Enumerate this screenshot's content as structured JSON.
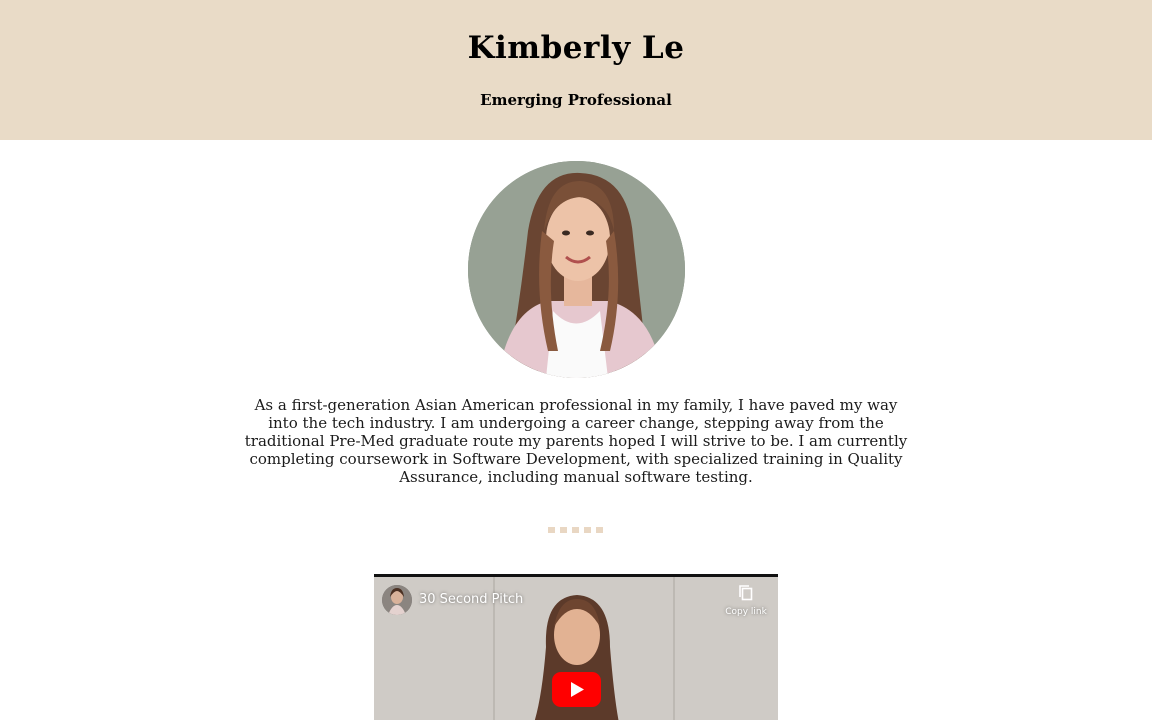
{
  "header": {
    "name": "Kimberly Le",
    "subtitle": "Emerging Professional"
  },
  "bio": {
    "text": "As a first-generation Asian American professional in my family, I have paved my way into the tech industry. I am undergoing a career change, stepping away from the traditional Pre-Med graduate route my parents hoped I will strive to be. I am currently completing coursework in Software Development, with specialized training in Quality Assurance, including manual software testing."
  },
  "video": {
    "title": "30 Second Pitch",
    "copy_link_label": "Copy link",
    "play_icon": "youtube-play-icon",
    "copy_icon": "copy-icon"
  },
  "colors": {
    "header_bg": "#e9dbc7",
    "divider_dots": "#e9d7c3",
    "youtube_red": "#ff0000"
  }
}
